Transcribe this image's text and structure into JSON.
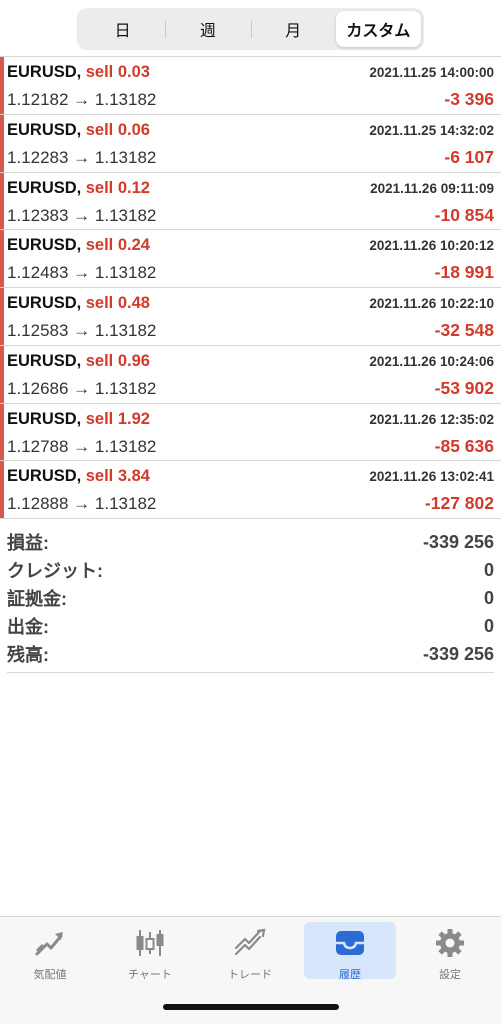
{
  "period_tabs": [
    {
      "label": "日",
      "active": false
    },
    {
      "label": "週",
      "active": false
    },
    {
      "label": "月",
      "active": false
    },
    {
      "label": "カスタム",
      "active": true
    }
  ],
  "trades": [
    {
      "symbol": "EURUSD,",
      "side": "sell 0.03",
      "time": "2021.11.25 14:00:00",
      "prices": "1.12182 → 1.13182",
      "profit": "-3 396"
    },
    {
      "symbol": "EURUSD,",
      "side": "sell 0.06",
      "time": "2021.11.25 14:32:02",
      "prices": "1.12283 → 1.13182",
      "profit": "-6 107"
    },
    {
      "symbol": "EURUSD,",
      "side": "sell 0.12",
      "time": "2021.11.26 09:11:09",
      "prices": "1.12383 → 1.13182",
      "profit": "-10 854"
    },
    {
      "symbol": "EURUSD,",
      "side": "sell 0.24",
      "time": "2021.11.26 10:20:12",
      "prices": "1.12483 → 1.13182",
      "profit": "-18 991"
    },
    {
      "symbol": "EURUSD,",
      "side": "sell 0.48",
      "time": "2021.11.26 10:22:10",
      "prices": "1.12583 → 1.13182",
      "profit": "-32 548"
    },
    {
      "symbol": "EURUSD,",
      "side": "sell 0.96",
      "time": "2021.11.26 10:24:06",
      "prices": "1.12686 → 1.13182",
      "profit": "-53 902"
    },
    {
      "symbol": "EURUSD,",
      "side": "sell 1.92",
      "time": "2021.11.26 12:35:02",
      "prices": "1.12788 → 1.13182",
      "profit": "-85 636"
    },
    {
      "symbol": "EURUSD,",
      "side": "sell 3.84",
      "time": "2021.11.26 13:02:41",
      "prices": "1.12888 → 1.13182",
      "profit": "-127 802"
    }
  ],
  "summary": [
    {
      "label": "損益:",
      "value": "-339 256"
    },
    {
      "label": "クレジット:",
      "value": "0"
    },
    {
      "label": "証拠金:",
      "value": "0"
    },
    {
      "label": "出金:",
      "value": "0"
    },
    {
      "label": "残高:",
      "value": "-339 256"
    }
  ],
  "tabbar": [
    {
      "label": "気配値",
      "icon": "quotes-icon",
      "active": false
    },
    {
      "label": "チャート",
      "icon": "candlestick-chart-icon",
      "active": false
    },
    {
      "label": "トレード",
      "icon": "trade-icon",
      "active": false
    },
    {
      "label": "履歴",
      "icon": "history-inbox-icon",
      "active": true
    },
    {
      "label": "設定",
      "icon": "gear-icon",
      "active": false
    }
  ],
  "colors": {
    "loss_red": "#d23a2a",
    "trade_bar": "#d8594a",
    "active_tab_bg": "#d8e6fb",
    "active_tab_accent": "#2a6bd4"
  }
}
